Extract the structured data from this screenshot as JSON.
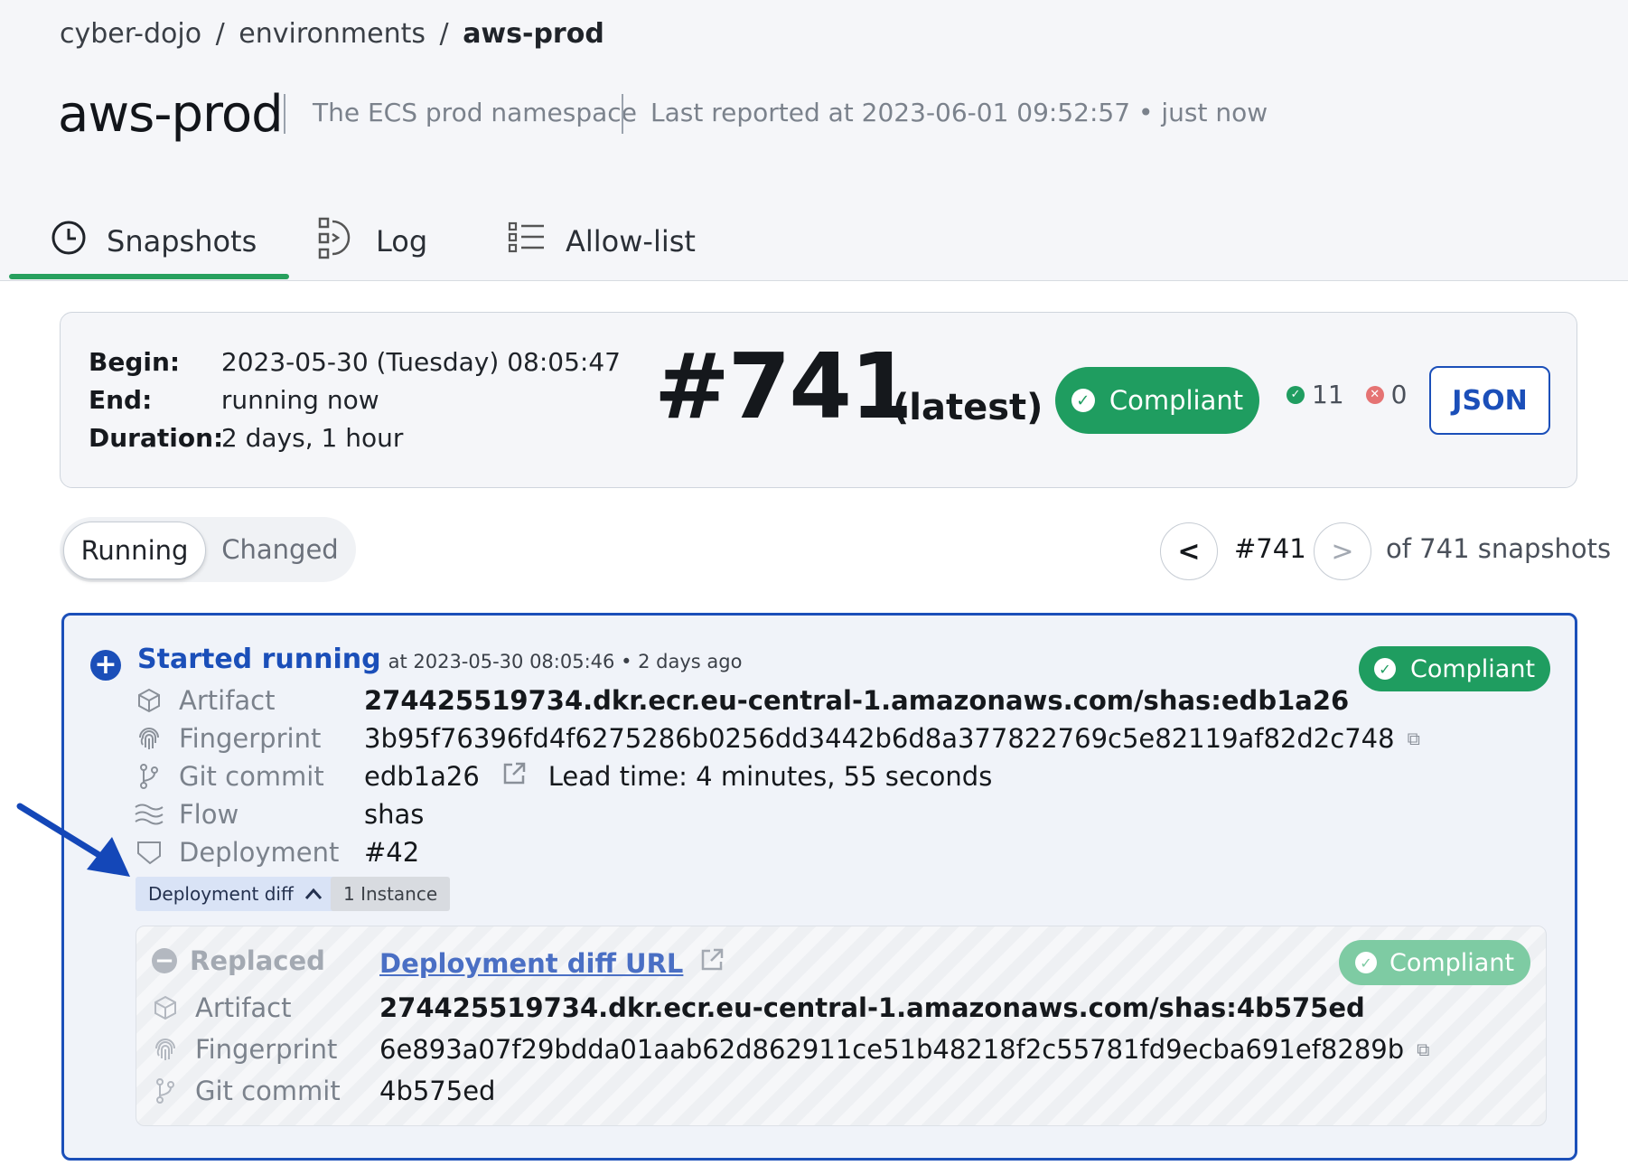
{
  "breadcrumb": {
    "org": "cyber-dojo",
    "section": "environments",
    "current": "aws-prod",
    "sep": "/"
  },
  "header": {
    "title": "aws-prod",
    "description": "The ECS prod namespace",
    "last_reported": "Last reported at 2023-06-01 09:52:57 • just now"
  },
  "tabs": [
    {
      "label": "Snapshots",
      "icon": "clock-icon",
      "active": true
    },
    {
      "label": "Log",
      "icon": "log-icon",
      "active": false
    },
    {
      "label": "Allow-list",
      "icon": "list-icon",
      "active": false
    }
  ],
  "summary": {
    "begin_label": "Begin:",
    "begin_value": "2023-05-30 (Tuesday) 08:05:47",
    "end_label": "End:",
    "end_value": "running now",
    "duration_label": "Duration:",
    "duration_value": "2 days, 1 hour",
    "snapshot_number": "#741",
    "latest_label": "(latest)",
    "status": "Compliant",
    "compliant_count": "11",
    "noncompliant_count": "0",
    "json_label": "JSON"
  },
  "filter": {
    "running": "Running",
    "changed": "Changed"
  },
  "pager": {
    "prev": "<",
    "current": "#741",
    "next": ">",
    "total": "of 741 snapshots"
  },
  "event": {
    "type_label": "Started running",
    "when": "at 2023-05-30 08:05:46 • 2 days ago",
    "status": "Compliant",
    "artifact_label": "Artifact",
    "artifact_value": "274425519734.dkr.ecr.eu-central-1.amazonaws.com/shas:edb1a26",
    "fingerprint_label": "Fingerprint",
    "fingerprint_value": "3b95f76396fd4f6275286b0256dd3442b6d8a377822769c5e82119af82d2c748",
    "commit_label": "Git commit",
    "commit_value": "edb1a26",
    "lead_time": "Lead time: 4 minutes, 55 seconds",
    "flow_label": "Flow",
    "flow_value": "shas",
    "deployment_label": "Deployment",
    "deployment_value": "#42",
    "diff_toggle": "Deployment diff",
    "instances": "1 Instance"
  },
  "replaced": {
    "label": "Replaced",
    "diff_url": "Deployment diff URL",
    "status": "Compliant",
    "artifact_label": "Artifact",
    "artifact_value": "274425519734.dkr.ecr.eu-central-1.amazonaws.com/shas:4b575ed",
    "fingerprint_label": "Fingerprint",
    "fingerprint_value": "6e893a07f29bdda01aab62d862911ce51b48218f2c55781fd9ecba691ef8289b",
    "commit_label": "Git commit",
    "commit_value": "4b575ed"
  },
  "colors": {
    "accent_blue": "#1b4fb9",
    "compliant_green": "#1f9d60",
    "tab_underline": "#27a05e",
    "error_red": "#e57373"
  }
}
